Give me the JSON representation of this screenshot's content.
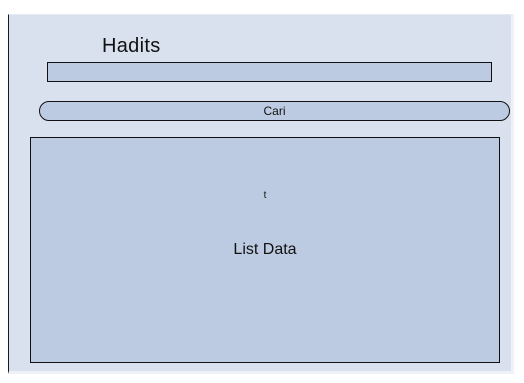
{
  "header": {
    "title": "Hadits"
  },
  "search": {
    "value": "",
    "placeholder": "",
    "button_label": "Cari"
  },
  "list": {
    "marker": "t",
    "label": "List Data"
  },
  "colors": {
    "panel": "#d9e1ef",
    "fill": "#bdcbe2",
    "border": "#111111"
  }
}
